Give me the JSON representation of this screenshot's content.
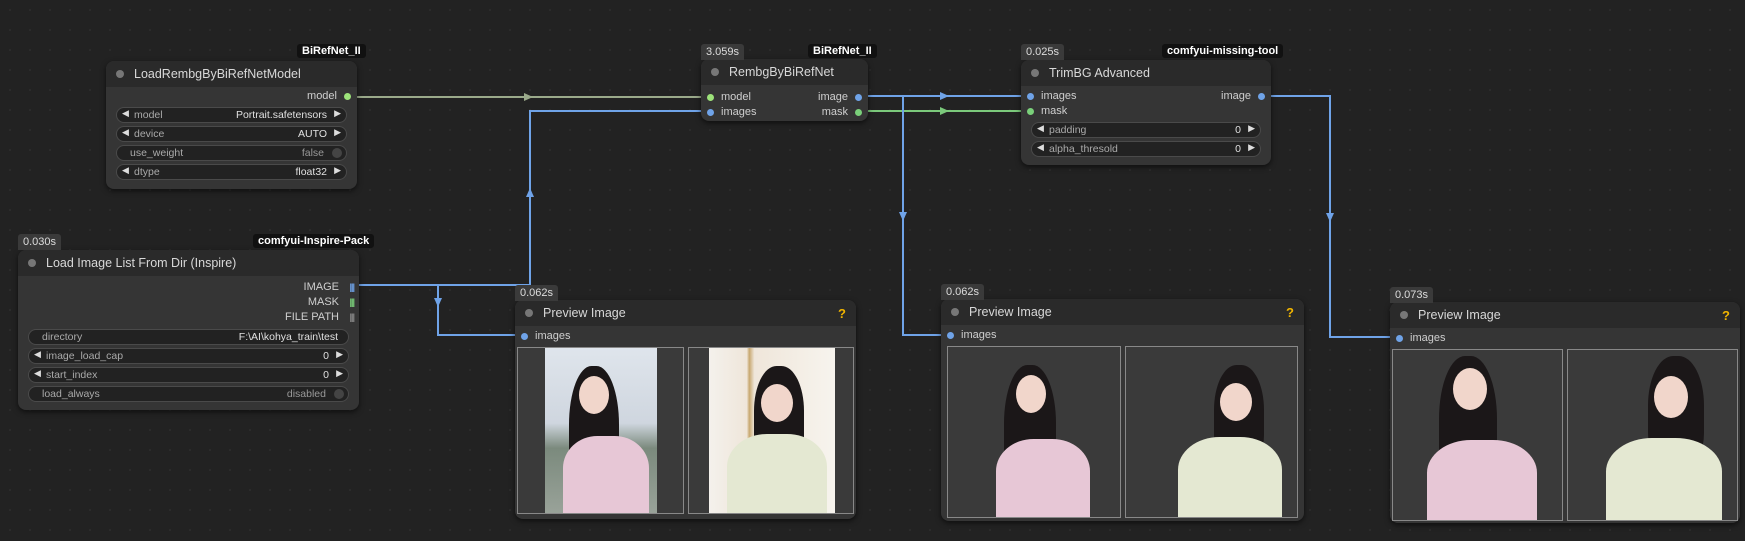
{
  "colors": {
    "model_port": "#9de37a",
    "image_port": "#6fa3e8",
    "mask_port": "#7ad07a",
    "wire_image": "#6fa3e8",
    "wire_model": "#9aa98a",
    "wire_mask": "#7bc97b"
  },
  "nodes": {
    "load_model": {
      "badge": "BiRefNet_II",
      "title": "LoadRembgByBiRefNetModel",
      "output": "model",
      "widgets": [
        {
          "name": "model",
          "value": "Portrait.safetensors"
        },
        {
          "name": "device",
          "value": "AUTO"
        },
        {
          "name": "use_weight",
          "value": "false"
        },
        {
          "name": "dtype",
          "value": "float32"
        }
      ]
    },
    "rembg": {
      "timer": "3.059s",
      "badge": "BiRefNet_II",
      "title": "RembgByBiRefNet",
      "inputs": [
        "model",
        "images"
      ],
      "outputs": [
        "image",
        "mask"
      ]
    },
    "trimbg": {
      "timer": "0.025s",
      "badge": "comfyui-missing-tool",
      "title": "TrimBG Advanced",
      "inputs": [
        "images",
        "mask"
      ],
      "output": "image",
      "widgets": [
        {
          "name": "padding",
          "value": "0"
        },
        {
          "name": "alpha_thresold",
          "value": "0"
        }
      ]
    },
    "load_images": {
      "timer": "0.030s",
      "badge": "comfyui-Inspire-Pack",
      "title": "Load Image List From Dir (Inspire)",
      "outputs": [
        "IMAGE",
        "MASK",
        "FILE PATH"
      ],
      "widgets": [
        {
          "name": "directory",
          "value": "F:\\AI\\kohya_train\\test"
        },
        {
          "name": "image_load_cap",
          "value": "0"
        },
        {
          "name": "start_index",
          "value": "0"
        },
        {
          "name": "load_always",
          "value": "disabled"
        }
      ]
    },
    "preview1": {
      "timer": "0.062s",
      "title": "Preview Image",
      "input": "images",
      "help": "?"
    },
    "preview2": {
      "timer": "0.062s",
      "title": "Preview Image",
      "input": "images",
      "help": "?"
    },
    "preview3": {
      "timer": "0.073s",
      "title": "Preview Image",
      "input": "images",
      "help": "?"
    }
  }
}
